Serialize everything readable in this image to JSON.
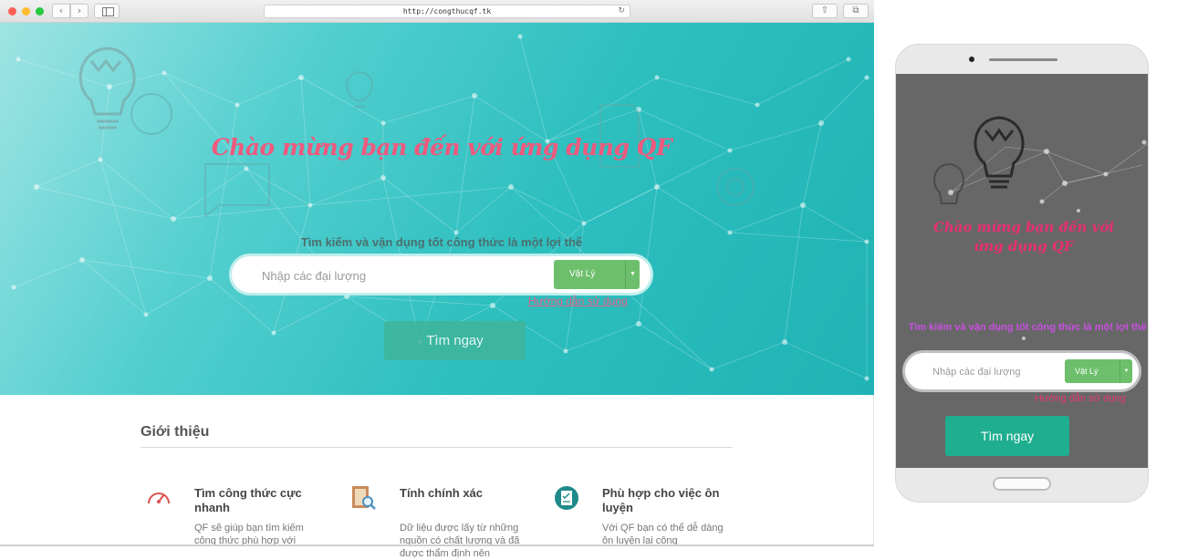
{
  "browser": {
    "url": "http://congthucqf.tk",
    "nav_back_icon": "chevron-left-icon",
    "nav_forward_icon": "chevron-right-icon",
    "reload_icon": "reload-icon",
    "share_icon": "share-icon",
    "tabs_icon": "tabs-icon"
  },
  "hero": {
    "title": "Chào mừng bạn đến với ứng dụng QF",
    "subtitle": "Tìm kiếm và vận dụng tốt công thức là một lợi thế",
    "search_placeholder": "Nhập các đại lượng",
    "subject_selected": "Vật Lý",
    "guide_link": "Hướng dẫn sử dụng",
    "search_button": "Tìm ngay"
  },
  "intro": {
    "title": "Giới thiệu",
    "features": [
      {
        "icon": "speedometer-icon",
        "title": "Tìm công thức cực nhanh",
        "desc": "QF sẽ giúp bạn tìm kiếm công thức phù hợp với"
      },
      {
        "icon": "notebook-search-icon",
        "title": "Tính chính xác",
        "desc": "Dữ liệu được lấy từ những nguồn có chất lượng và đã được thẩm định nên"
      },
      {
        "icon": "checklist-icon",
        "title": "Phù hợp cho việc ôn luyện",
        "desc": "Với QF bạn có thể dễ dàng ôn luyện lại công"
      }
    ]
  },
  "mobile": {
    "title": "Chào mừng bạn đến với ứng dụng QF",
    "subtitle": "Tìm kiếm và vận dụng tốt công thức là một lợi thế",
    "search_placeholder": "Nhập các đại lượng",
    "subject_selected": "Vật Lý",
    "guide_link": "Hướng dẫn sử dụng",
    "search_button": "Tìm ngay"
  },
  "colors": {
    "hero_start": "#9fe4e4",
    "hero_end": "#1fb3b5",
    "title_pink": "#ee5a7e",
    "select_green": "#6dbf6c",
    "button_teal": "#3fb59b",
    "mobile_bg": "#676767",
    "mobile_subtitle": "#c94fe0"
  }
}
